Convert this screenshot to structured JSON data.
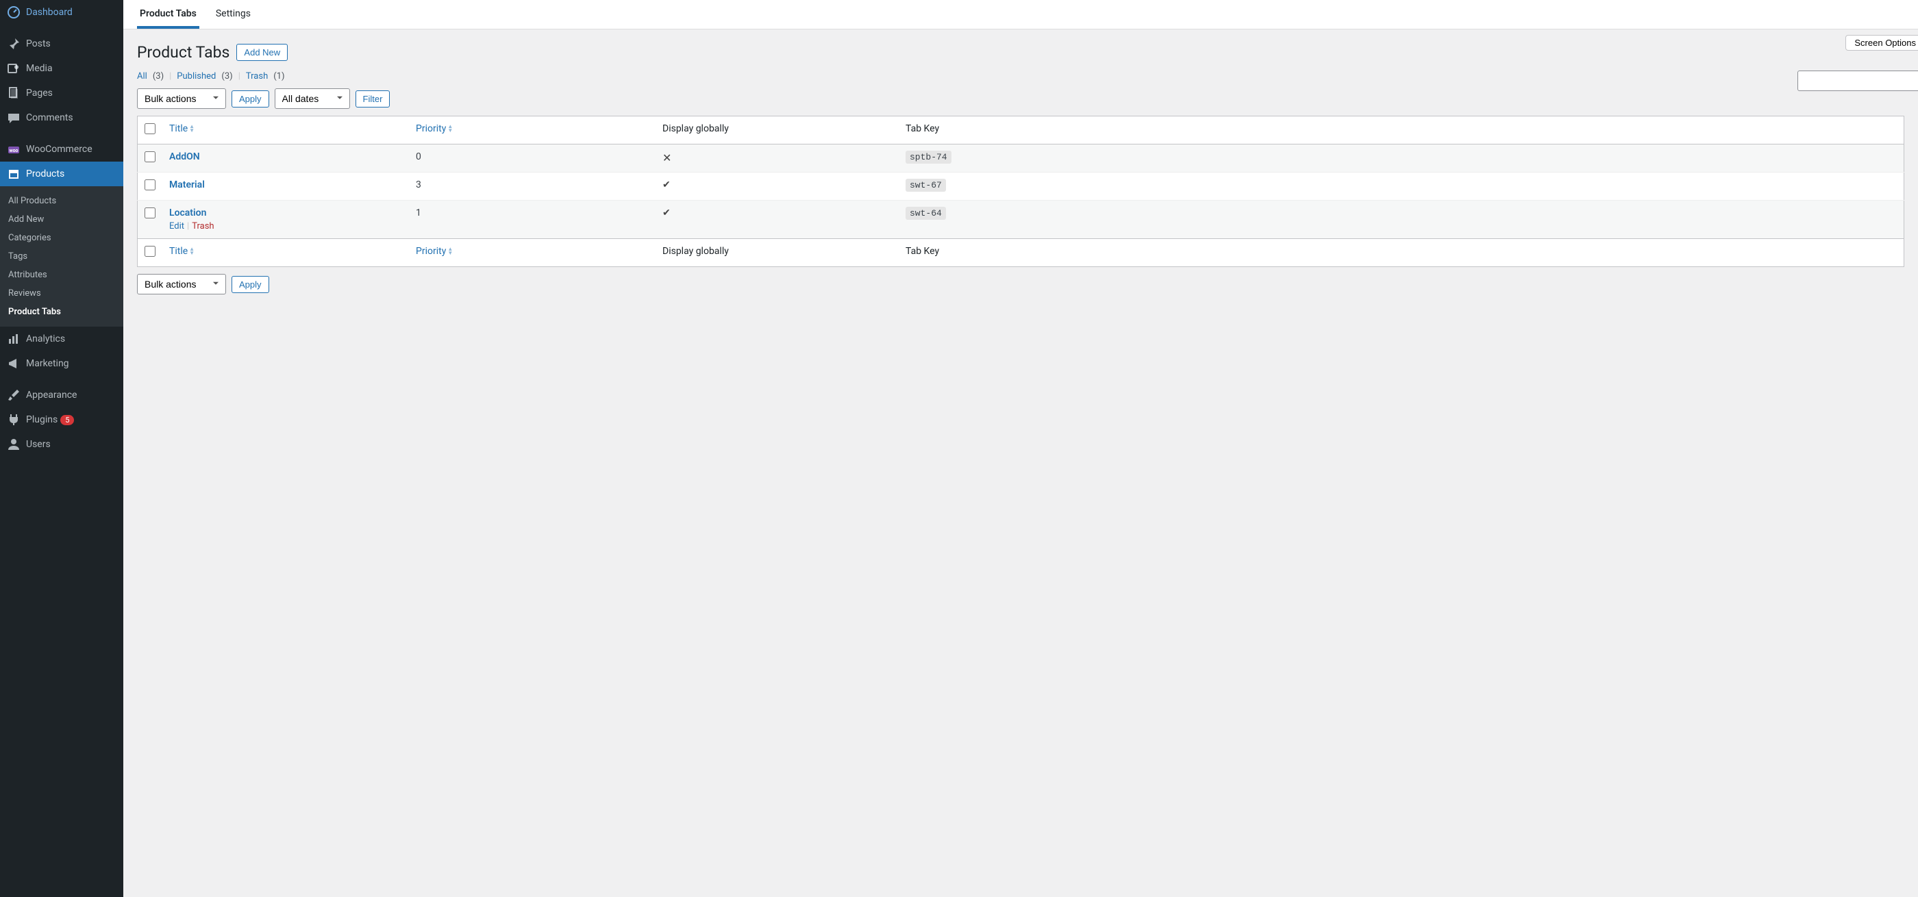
{
  "sidebar": {
    "items": [
      {
        "label": "Dashboard",
        "icon": "dashboard"
      },
      {
        "label": "Posts",
        "icon": "pin"
      },
      {
        "label": "Media",
        "icon": "media"
      },
      {
        "label": "Pages",
        "icon": "page"
      },
      {
        "label": "Comments",
        "icon": "comment"
      },
      {
        "label": "WooCommerce",
        "icon": "woo"
      },
      {
        "label": "Products",
        "icon": "archive",
        "active": true
      },
      {
        "label": "Analytics",
        "icon": "chart"
      },
      {
        "label": "Marketing",
        "icon": "megaphone"
      },
      {
        "label": "Appearance",
        "icon": "brush"
      },
      {
        "label": "Plugins",
        "icon": "plug",
        "badge": "5"
      },
      {
        "label": "Users",
        "icon": "user"
      }
    ],
    "submenu": [
      {
        "label": "All Products"
      },
      {
        "label": "Add New"
      },
      {
        "label": "Categories"
      },
      {
        "label": "Tags"
      },
      {
        "label": "Attributes"
      },
      {
        "label": "Reviews"
      },
      {
        "label": "Product Tabs",
        "current": true
      }
    ]
  },
  "tabs": [
    {
      "label": "Product Tabs",
      "active": true
    },
    {
      "label": "Settings"
    }
  ],
  "page": {
    "title": "Product Tabs",
    "add_new": "Add New",
    "screen_options": "Screen Options"
  },
  "filters": {
    "views": [
      {
        "label": "All",
        "count": "(3)"
      },
      {
        "label": "Published",
        "count": "(3)"
      },
      {
        "label": "Trash",
        "count": "(1)"
      }
    ],
    "bulk_label": "Bulk actions",
    "apply": "Apply",
    "dates_label": "All dates",
    "filter": "Filter"
  },
  "columns": {
    "title": "Title",
    "priority": "Priority",
    "global": "Display globally",
    "tabkey": "Tab Key"
  },
  "rows": [
    {
      "title": "AddON",
      "priority": "0",
      "global": "no",
      "tabkey": "sptb-74"
    },
    {
      "title": "Material",
      "priority": "3",
      "global": "yes",
      "tabkey": "swt-67"
    },
    {
      "title": "Location",
      "priority": "1",
      "global": "yes",
      "tabkey": "swt-64",
      "actions": {
        "edit": "Edit",
        "trash": "Trash"
      }
    }
  ]
}
